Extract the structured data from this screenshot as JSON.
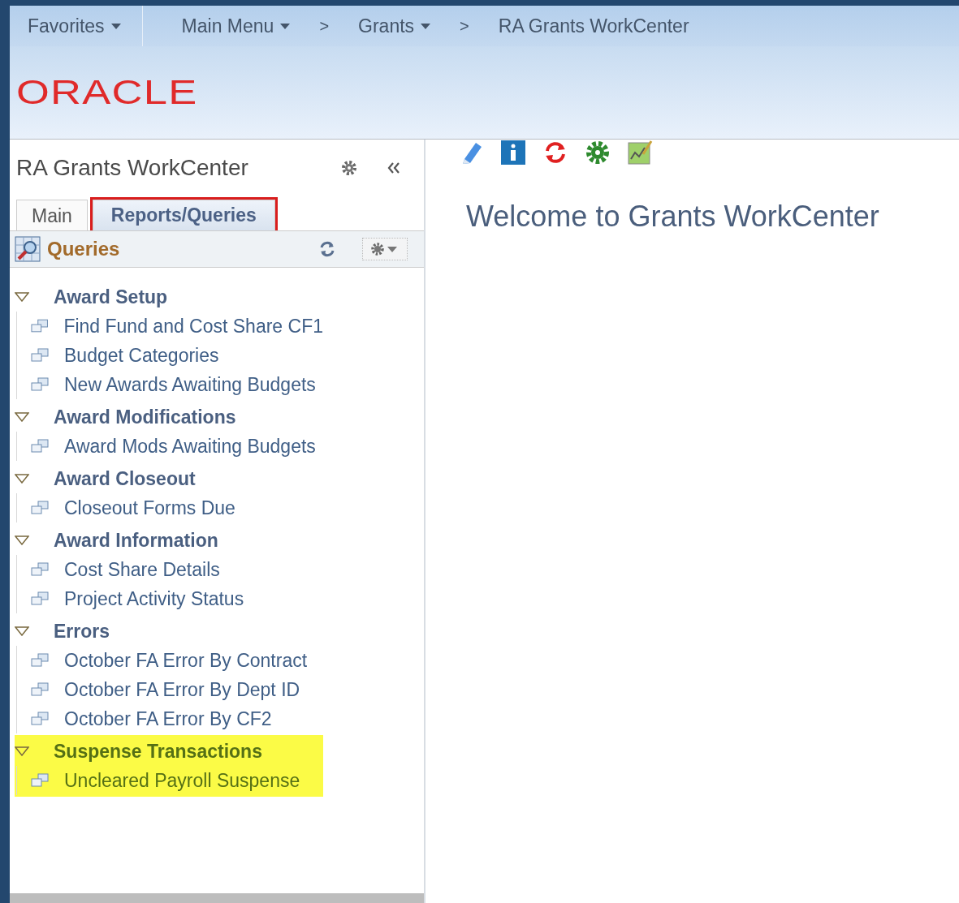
{
  "nav": [
    {
      "label": "Favorites",
      "kind": "menu"
    },
    {
      "label": "Main Menu",
      "kind": "menu"
    },
    {
      "label": ">",
      "kind": "separator"
    },
    {
      "label": "Grants",
      "kind": "menu"
    },
    {
      "label": ">",
      "kind": "separator"
    },
    {
      "label": "RA Grants WorkCenter",
      "kind": "crumb"
    }
  ],
  "logo": "ORACLE",
  "pane": {
    "title": "RA Grants WorkCenter",
    "tabs": [
      {
        "label": "Main",
        "selected": false,
        "highlighted": false
      },
      {
        "label": "Reports/Queries",
        "selected": true,
        "highlighted": true
      }
    ],
    "section": {
      "title": "Queries",
      "groups": [
        {
          "label": "Award Setup",
          "expanded": true,
          "highlighted": false,
          "children": [
            {
              "label": "Find Fund and Cost Share CF1"
            },
            {
              "label": "Budget Categories"
            },
            {
              "label": "New Awards Awaiting Budgets"
            }
          ]
        },
        {
          "label": "Award Modifications",
          "expanded": true,
          "highlighted": false,
          "children": [
            {
              "label": "Award Mods Awaiting Budgets"
            }
          ]
        },
        {
          "label": "Award Closeout",
          "expanded": true,
          "highlighted": false,
          "children": [
            {
              "label": "Closeout Forms Due"
            }
          ]
        },
        {
          "label": "Award Information",
          "expanded": true,
          "highlighted": false,
          "children": [
            {
              "label": "Cost Share Details"
            },
            {
              "label": "Project Activity Status"
            }
          ]
        },
        {
          "label": "Errors",
          "expanded": true,
          "highlighted": false,
          "children": [
            {
              "label": "October FA Error By Contract"
            },
            {
              "label": "October FA Error By Dept ID"
            },
            {
              "label": "October FA Error By CF2"
            }
          ]
        },
        {
          "label": "Suspense Transactions",
          "expanded": true,
          "highlighted": true,
          "children": [
            {
              "label": "Uncleared Payroll Suspense"
            }
          ]
        }
      ]
    }
  },
  "main": {
    "heading": "Welcome to Grants WorkCenter"
  }
}
